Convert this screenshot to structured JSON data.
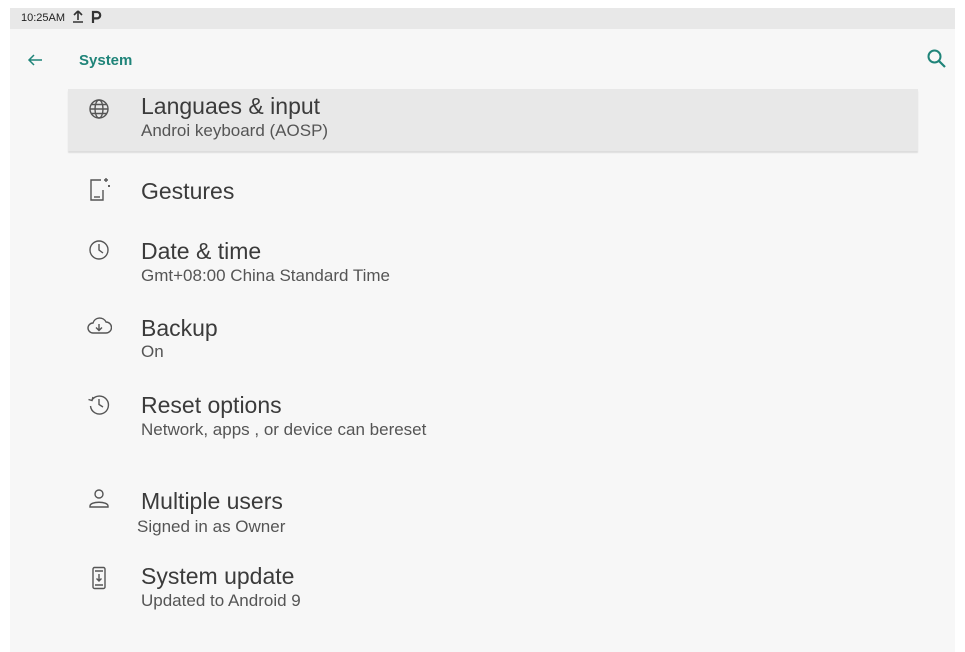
{
  "status_bar": {
    "time": "10:25AM",
    "icons": [
      "upload-icon",
      "parking-icon"
    ]
  },
  "app_bar": {
    "title": "System",
    "back_icon": "back-arrow-icon",
    "search_icon": "search-icon",
    "accent_color": "#1f8479"
  },
  "items": [
    {
      "icon": "globe-icon",
      "label": "Languaes & input",
      "summary": "Androi keyboard (AOSP)",
      "selected": true
    },
    {
      "icon": "gestures-icon",
      "label": "Gestures",
      "summary": ""
    },
    {
      "icon": "clock-icon",
      "label": "Date & time",
      "summary": "Gmt+08:00 China Standard Time"
    },
    {
      "icon": "cloud-backup-icon",
      "label": "Backup",
      "summary": "On"
    },
    {
      "icon": "history-icon",
      "label": "Reset options",
      "summary": "Network, apps , or device can bereset"
    },
    {
      "icon": "user-icon",
      "label": "Multiple users",
      "summary": "Signed in as Owner"
    },
    {
      "icon": "system-update-icon",
      "label": "System update",
      "summary": "Updated to Android 9"
    }
  ]
}
